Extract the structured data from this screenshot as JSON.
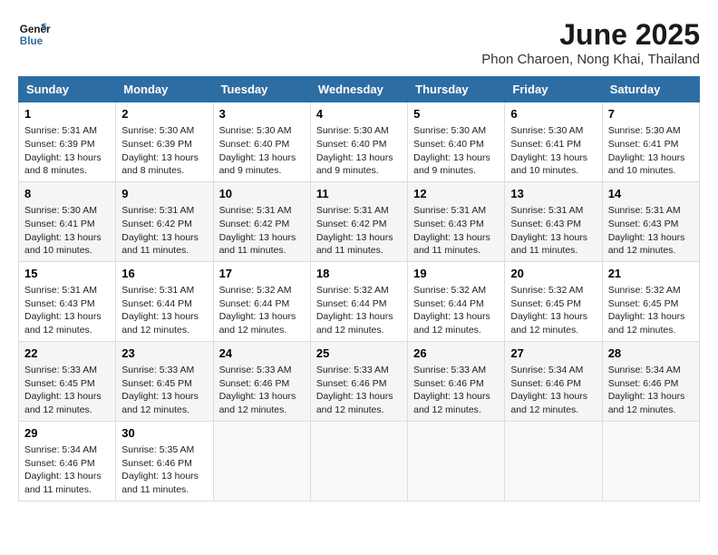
{
  "logo": {
    "line1": "General",
    "line2": "Blue"
  },
  "title": "June 2025",
  "subtitle": "Phon Charoen, Nong Khai, Thailand",
  "days_of_week": [
    "Sunday",
    "Monday",
    "Tuesday",
    "Wednesday",
    "Thursday",
    "Friday",
    "Saturday"
  ],
  "weeks": [
    [
      {
        "day": "1",
        "lines": [
          "Sunrise: 5:31 AM",
          "Sunset: 6:39 PM",
          "Daylight: 13 hours",
          "and 8 minutes."
        ]
      },
      {
        "day": "2",
        "lines": [
          "Sunrise: 5:30 AM",
          "Sunset: 6:39 PM",
          "Daylight: 13 hours",
          "and 8 minutes."
        ]
      },
      {
        "day": "3",
        "lines": [
          "Sunrise: 5:30 AM",
          "Sunset: 6:40 PM",
          "Daylight: 13 hours",
          "and 9 minutes."
        ]
      },
      {
        "day": "4",
        "lines": [
          "Sunrise: 5:30 AM",
          "Sunset: 6:40 PM",
          "Daylight: 13 hours",
          "and 9 minutes."
        ]
      },
      {
        "day": "5",
        "lines": [
          "Sunrise: 5:30 AM",
          "Sunset: 6:40 PM",
          "Daylight: 13 hours",
          "and 9 minutes."
        ]
      },
      {
        "day": "6",
        "lines": [
          "Sunrise: 5:30 AM",
          "Sunset: 6:41 PM",
          "Daylight: 13 hours",
          "and 10 minutes."
        ]
      },
      {
        "day": "7",
        "lines": [
          "Sunrise: 5:30 AM",
          "Sunset: 6:41 PM",
          "Daylight: 13 hours",
          "and 10 minutes."
        ]
      }
    ],
    [
      {
        "day": "8",
        "lines": [
          "Sunrise: 5:30 AM",
          "Sunset: 6:41 PM",
          "Daylight: 13 hours",
          "and 10 minutes."
        ]
      },
      {
        "day": "9",
        "lines": [
          "Sunrise: 5:31 AM",
          "Sunset: 6:42 PM",
          "Daylight: 13 hours",
          "and 11 minutes."
        ]
      },
      {
        "day": "10",
        "lines": [
          "Sunrise: 5:31 AM",
          "Sunset: 6:42 PM",
          "Daylight: 13 hours",
          "and 11 minutes."
        ]
      },
      {
        "day": "11",
        "lines": [
          "Sunrise: 5:31 AM",
          "Sunset: 6:42 PM",
          "Daylight: 13 hours",
          "and 11 minutes."
        ]
      },
      {
        "day": "12",
        "lines": [
          "Sunrise: 5:31 AM",
          "Sunset: 6:43 PM",
          "Daylight: 13 hours",
          "and 11 minutes."
        ]
      },
      {
        "day": "13",
        "lines": [
          "Sunrise: 5:31 AM",
          "Sunset: 6:43 PM",
          "Daylight: 13 hours",
          "and 11 minutes."
        ]
      },
      {
        "day": "14",
        "lines": [
          "Sunrise: 5:31 AM",
          "Sunset: 6:43 PM",
          "Daylight: 13 hours",
          "and 12 minutes."
        ]
      }
    ],
    [
      {
        "day": "15",
        "lines": [
          "Sunrise: 5:31 AM",
          "Sunset: 6:43 PM",
          "Daylight: 13 hours",
          "and 12 minutes."
        ]
      },
      {
        "day": "16",
        "lines": [
          "Sunrise: 5:31 AM",
          "Sunset: 6:44 PM",
          "Daylight: 13 hours",
          "and 12 minutes."
        ]
      },
      {
        "day": "17",
        "lines": [
          "Sunrise: 5:32 AM",
          "Sunset: 6:44 PM",
          "Daylight: 13 hours",
          "and 12 minutes."
        ]
      },
      {
        "day": "18",
        "lines": [
          "Sunrise: 5:32 AM",
          "Sunset: 6:44 PM",
          "Daylight: 13 hours",
          "and 12 minutes."
        ]
      },
      {
        "day": "19",
        "lines": [
          "Sunrise: 5:32 AM",
          "Sunset: 6:44 PM",
          "Daylight: 13 hours",
          "and 12 minutes."
        ]
      },
      {
        "day": "20",
        "lines": [
          "Sunrise: 5:32 AM",
          "Sunset: 6:45 PM",
          "Daylight: 13 hours",
          "and 12 minutes."
        ]
      },
      {
        "day": "21",
        "lines": [
          "Sunrise: 5:32 AM",
          "Sunset: 6:45 PM",
          "Daylight: 13 hours",
          "and 12 minutes."
        ]
      }
    ],
    [
      {
        "day": "22",
        "lines": [
          "Sunrise: 5:33 AM",
          "Sunset: 6:45 PM",
          "Daylight: 13 hours",
          "and 12 minutes."
        ]
      },
      {
        "day": "23",
        "lines": [
          "Sunrise: 5:33 AM",
          "Sunset: 6:45 PM",
          "Daylight: 13 hours",
          "and 12 minutes."
        ]
      },
      {
        "day": "24",
        "lines": [
          "Sunrise: 5:33 AM",
          "Sunset: 6:46 PM",
          "Daylight: 13 hours",
          "and 12 minutes."
        ]
      },
      {
        "day": "25",
        "lines": [
          "Sunrise: 5:33 AM",
          "Sunset: 6:46 PM",
          "Daylight: 13 hours",
          "and 12 minutes."
        ]
      },
      {
        "day": "26",
        "lines": [
          "Sunrise: 5:33 AM",
          "Sunset: 6:46 PM",
          "Daylight: 13 hours",
          "and 12 minutes."
        ]
      },
      {
        "day": "27",
        "lines": [
          "Sunrise: 5:34 AM",
          "Sunset: 6:46 PM",
          "Daylight: 13 hours",
          "and 12 minutes."
        ]
      },
      {
        "day": "28",
        "lines": [
          "Sunrise: 5:34 AM",
          "Sunset: 6:46 PM",
          "Daylight: 13 hours",
          "and 12 minutes."
        ]
      }
    ],
    [
      {
        "day": "29",
        "lines": [
          "Sunrise: 5:34 AM",
          "Sunset: 6:46 PM",
          "Daylight: 13 hours",
          "and 11 minutes."
        ]
      },
      {
        "day": "30",
        "lines": [
          "Sunrise: 5:35 AM",
          "Sunset: 6:46 PM",
          "Daylight: 13 hours",
          "and 11 minutes."
        ]
      },
      null,
      null,
      null,
      null,
      null
    ]
  ]
}
